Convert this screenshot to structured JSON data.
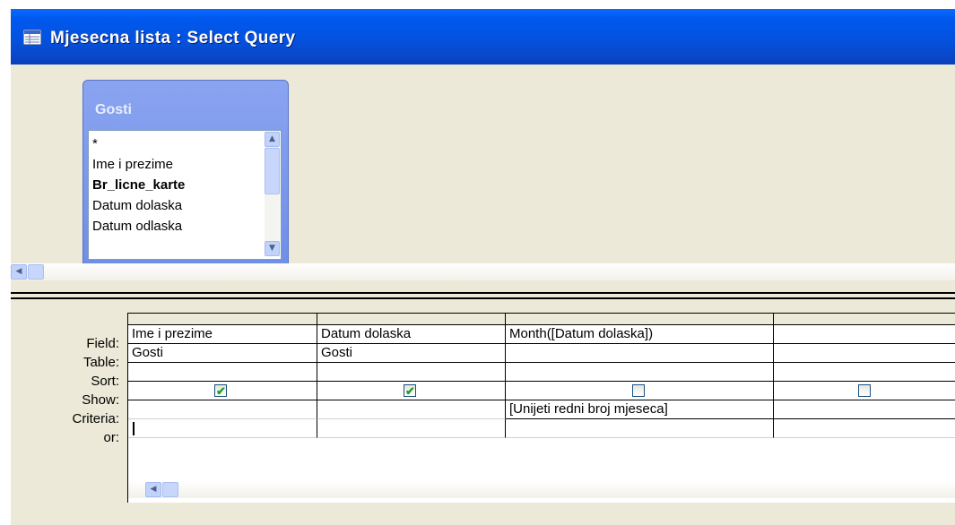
{
  "window": {
    "title": "Mjesecna lista : Select Query",
    "icon": "query-icon"
  },
  "field_list": {
    "table_name": "Gosti",
    "items": [
      {
        "label": "*",
        "bold": false
      },
      {
        "label": "Ime i prezime",
        "bold": false
      },
      {
        "label": "Br_licne_karte",
        "bold": true
      },
      {
        "label": "Datum dolaska",
        "bold": false
      },
      {
        "label": "Datum odlaska",
        "bold": false
      }
    ],
    "scroll_up_glyph": "▲",
    "scroll_down_glyph": "▼"
  },
  "upper_scroll": {
    "left_glyph": "◀"
  },
  "design_grid": {
    "row_labels": [
      "Field:",
      "Table:",
      "Sort:",
      "Show:",
      "Criteria:",
      "or:"
    ],
    "columns": [
      {
        "field": "Ime i prezime",
        "table": "Gosti",
        "sort": "",
        "show": true,
        "criteria": "",
        "or": ""
      },
      {
        "field": "Datum dolaska",
        "table": "Gosti",
        "sort": "",
        "show": true,
        "criteria": "",
        "or": ""
      },
      {
        "field": "Month([Datum dolaska])",
        "table": "",
        "sort": "",
        "show": false,
        "criteria": "[Unijeti redni broj mjeseca]",
        "or": ""
      },
      {
        "field": "",
        "table": "",
        "sort": "",
        "show": false,
        "criteria": "",
        "or": ""
      }
    ],
    "checked_glyph": "✔",
    "scroll_left_glyph": "◀"
  }
}
